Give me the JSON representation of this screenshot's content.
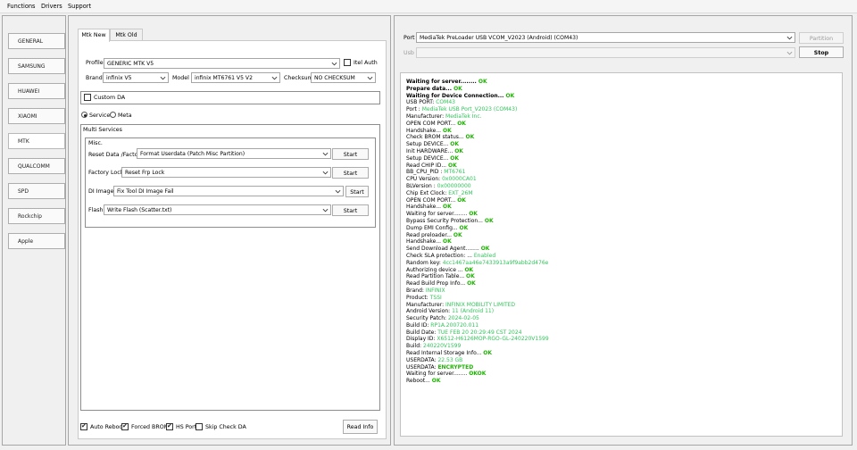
{
  "menu": [
    "Functions",
    "Drivers",
    "Support"
  ],
  "sidebar": [
    "GENERAL",
    "SAMSUNG",
    "HUAWEI",
    "XIAOMI",
    "MTK",
    "QUALCOMM",
    "SPD",
    "Rockchip",
    "Apple"
  ],
  "tabs": [
    "Mtk New",
    "Mtk Old"
  ],
  "profile": {
    "label": "Profile",
    "value": "GENERIC MTK V5",
    "itel_auth": "Itel Auth"
  },
  "brand": {
    "label": "Brand",
    "value": "infinix V5"
  },
  "model": {
    "label": "Model",
    "value": "infinix MT6761 V5 V2"
  },
  "checksum": {
    "label": "Checksum",
    "value": "NO CHECKSUM"
  },
  "custom_da": "Custom DA",
  "mode": {
    "service": "Service",
    "meta": "Meta"
  },
  "multi_services": {
    "title": "Multi Services",
    "misc": "Misc.",
    "rows": [
      {
        "label": "Reset Data /Factory",
        "value": "Format Userdata (Patch Misc Partition)",
        "button": "Start"
      },
      {
        "label": "Factory Lock",
        "value": "Reset Frp Lock",
        "button": "Start"
      },
      {
        "label": "DI Image",
        "value": "Fix Tool DI Image Fail",
        "button": "Start"
      },
      {
        "label": "Flash",
        "value": "Write Flash (Scatter.txt)",
        "button": "Start"
      }
    ]
  },
  "bottom": {
    "auto_reboot": "Auto Reboot",
    "forced_brom": "Forced BROM",
    "hs_port": "HS Port",
    "skip_check_da": "Skip Check DA",
    "read_info": "Read Info"
  },
  "port": {
    "label": "Port",
    "value": "MediaTek PreLoader USB VCOM_V2023 (Android) (COM43)",
    "partition_button": "Partition",
    "usb_label": "Usb",
    "stop_button": "Stop"
  },
  "log": [
    [
      [
        "Waiting for server........ ",
        "b"
      ],
      [
        "OK",
        "ok"
      ]
    ],
    [
      [
        "Prepare data... ",
        "b"
      ],
      [
        "OK",
        "ok"
      ]
    ],
    [
      [
        "Waiting for Device Connection... ",
        "b"
      ],
      [
        "OK",
        "ok"
      ]
    ],
    [
      [
        "USB PORT: ",
        ""
      ],
      [
        "COM43",
        "val"
      ]
    ],
    [
      [
        "Port : ",
        ""
      ],
      [
        "MediaTek USB Port_V2023 (COM43)",
        "val"
      ]
    ],
    [
      [
        "Manufacturer: ",
        ""
      ],
      [
        "MediaTek Inc.",
        "val"
      ]
    ],
    [
      [
        "OPEN COM PORT... ",
        ""
      ],
      [
        "OK",
        "ok"
      ]
    ],
    [
      [
        "Handshake... ",
        ""
      ],
      [
        "OK",
        "ok"
      ]
    ],
    [
      [
        "Check BROM status... ",
        ""
      ],
      [
        "OK",
        "ok"
      ]
    ],
    [
      [
        "Setup DEVICE... ",
        ""
      ],
      [
        "OK",
        "ok"
      ]
    ],
    [
      [
        "Init HARDWARE... ",
        ""
      ],
      [
        "OK",
        "ok"
      ]
    ],
    [
      [
        "Setup DEVICE... ",
        ""
      ],
      [
        "OK",
        "ok"
      ]
    ],
    [
      [
        "Read CHIP ID... ",
        ""
      ],
      [
        "OK",
        "ok"
      ]
    ],
    [
      [
        "BB_CPU_PID : ",
        ""
      ],
      [
        "MT6761",
        "val"
      ]
    ],
    [
      [
        "CPU Version: ",
        ""
      ],
      [
        "0x0000CA01",
        "val"
      ]
    ],
    [
      [
        "BLVersion : ",
        ""
      ],
      [
        "0x00000000",
        "val"
      ]
    ],
    [
      [
        "Chip Ext Clock: ",
        ""
      ],
      [
        "EXT_26M",
        "val"
      ]
    ],
    [
      [
        "OPEN COM PORT... ",
        ""
      ],
      [
        "OK",
        "ok"
      ]
    ],
    [
      [
        "Handshake... ",
        ""
      ],
      [
        "OK",
        "ok"
      ]
    ],
    [
      [
        "Waiting for server........ ",
        ""
      ],
      [
        "OK",
        "ok"
      ]
    ],
    [
      [
        "Bypass Security Protection... ",
        ""
      ],
      [
        "OK",
        "ok"
      ]
    ],
    [
      [
        "Dump EMI Config... ",
        ""
      ],
      [
        "OK",
        "ok"
      ]
    ],
    [
      [
        "Read preloader... ",
        ""
      ],
      [
        "OK",
        "ok"
      ]
    ],
    [
      [
        "Handshake... ",
        ""
      ],
      [
        "OK",
        "ok"
      ]
    ],
    [
      [
        "Send Download Agent........ ",
        ""
      ],
      [
        "OK",
        "ok"
      ]
    ],
    [
      [
        "Check SLA protection: ... ",
        ""
      ],
      [
        "Enabled",
        "val"
      ]
    ],
    [
      [
        "Random key: ",
        ""
      ],
      [
        "4cc1467aa46e7433913a9f9abb2d476e",
        "val"
      ]
    ],
    [
      [
        "Authorizing device ... ",
        ""
      ],
      [
        "OK",
        "ok"
      ]
    ],
    [
      [
        "Read Partition Table... ",
        ""
      ],
      [
        "OK",
        "ok"
      ]
    ],
    [
      [
        "Read Build Prop Info... ",
        ""
      ],
      [
        "OK",
        "ok"
      ]
    ],
    [
      [
        " Brand: ",
        ""
      ],
      [
        "INFINIX",
        "val"
      ]
    ],
    [
      [
        " Product: ",
        ""
      ],
      [
        "TSSI",
        "val"
      ]
    ],
    [
      [
        " Manufacturer: ",
        ""
      ],
      [
        "INFINIX MOBILITY LIMITED",
        "val"
      ]
    ],
    [
      [
        " Android Version: ",
        ""
      ],
      [
        "11 (Android 11)",
        "val"
      ]
    ],
    [
      [
        " Security Patch: ",
        ""
      ],
      [
        "2024-02-05",
        "val"
      ]
    ],
    [
      [
        " Build ID: ",
        ""
      ],
      [
        "RP1A.200720.011",
        "val"
      ]
    ],
    [
      [
        " Build Date: ",
        ""
      ],
      [
        "TUE FEB 20 20:29:49 CST 2024",
        "val"
      ]
    ],
    [
      [
        " Display ID: ",
        ""
      ],
      [
        "X6512-H6126MOP-RGO-GL-240220V1599",
        "val"
      ]
    ],
    [
      [
        " Build: ",
        ""
      ],
      [
        "240220V1599",
        "val"
      ]
    ],
    [
      [
        "Read Internal Storage Info... ",
        ""
      ],
      [
        "OK",
        "ok"
      ]
    ],
    [
      [
        " USERDATA: ",
        ""
      ],
      [
        "22.53 GB",
        "val"
      ]
    ],
    [
      [
        " USERDATA: ",
        ""
      ],
      [
        "ENCRYPTED",
        "ok"
      ]
    ],
    [
      [
        "Waiting for server........ ",
        ""
      ],
      [
        "OKOK",
        "ok"
      ]
    ],
    [
      [
        "Reboot... ",
        ""
      ],
      [
        "OK",
        "ok"
      ]
    ]
  ]
}
